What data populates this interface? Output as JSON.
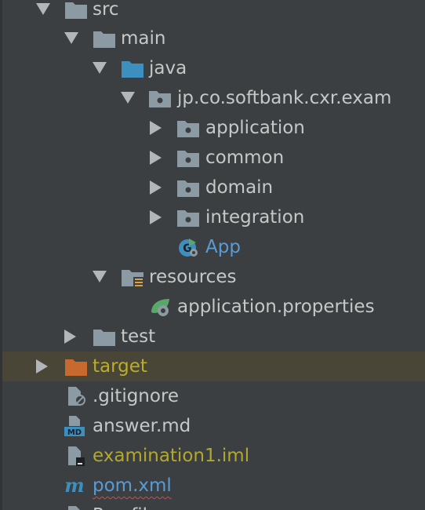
{
  "tree": {
    "items": [
      {
        "label": "src"
      },
      {
        "label": "main"
      },
      {
        "label": "java"
      },
      {
        "label": "jp.co.softbank.cxr.exam"
      },
      {
        "label": "application"
      },
      {
        "label": "common"
      },
      {
        "label": "domain"
      },
      {
        "label": "integration"
      },
      {
        "label": "App"
      },
      {
        "label": "resources"
      },
      {
        "label": "application.properties"
      },
      {
        "label": "test"
      },
      {
        "label": "target"
      },
      {
        "label": ".gitignore"
      },
      {
        "label": "answer.md"
      },
      {
        "label": "examination1.iml"
      },
      {
        "label": "pom.xml"
      },
      {
        "label": "Procfile"
      }
    ]
  },
  "colors": {
    "background": "#3c3f41",
    "selected_row": "#4a4637",
    "text": "#c5c8c6",
    "class_blue": "#5a9bd5",
    "excluded_olive": "#b2a82c",
    "folder_gray": "#8c9aa4",
    "source_folder_blue": "#3d8fbf",
    "excluded_folder_orange": "#c86a2f"
  }
}
